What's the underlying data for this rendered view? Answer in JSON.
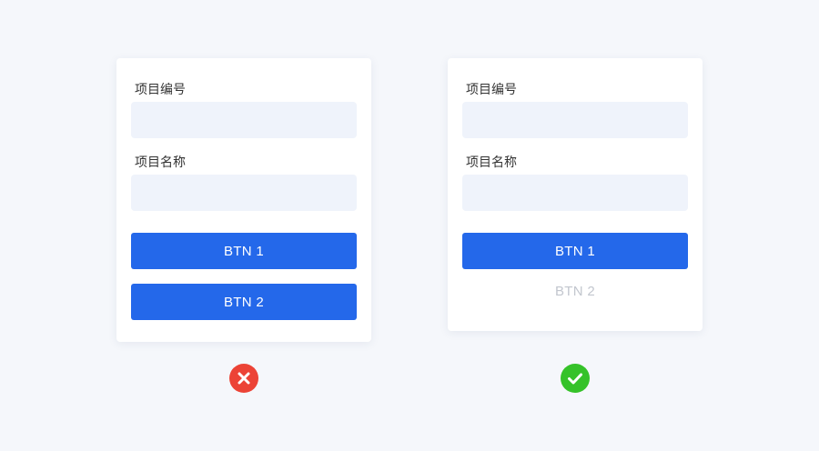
{
  "examples": {
    "wrong": {
      "field1_label": "项目编号",
      "field2_label": "项目名称",
      "button1_label": "BTN 1",
      "button2_label": "BTN 2",
      "status_icon": "close-icon",
      "status_color": "#ec4336"
    },
    "right": {
      "field1_label": "项目编号",
      "field2_label": "项目名称",
      "button1_label": "BTN 1",
      "button2_label": "BTN 2",
      "status_icon": "check-icon",
      "status_color": "#35c229"
    }
  },
  "colors": {
    "page_background": "#f5f7fb",
    "card_background": "#ffffff",
    "input_background": "#eff3fb",
    "primary_button": "#2468ea",
    "disabled_text": "#c2c6ce"
  }
}
